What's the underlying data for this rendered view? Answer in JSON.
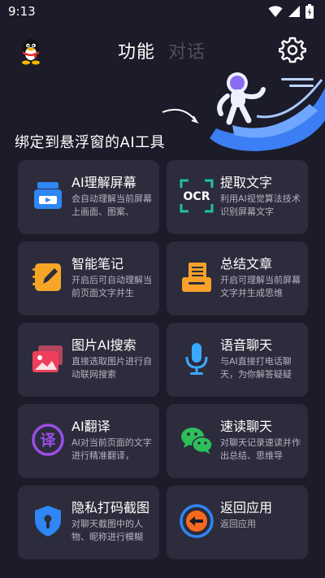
{
  "status_bar": {
    "time": "9:13",
    "icons": [
      "wifi-icon",
      "signal-icon",
      "battery-icon"
    ]
  },
  "header": {
    "tabs": [
      {
        "label": "功能",
        "active": true
      },
      {
        "label": "对话",
        "active": false
      }
    ],
    "icons": [
      "qq-penguin-icon",
      "settings-gear-icon"
    ]
  },
  "hero": {
    "text": "绑定到悬浮窗的AI工具"
  },
  "features": [
    {
      "title": "AI理解屏幕",
      "desc": "会自动理解当前屏幕上画面、图案、",
      "icon": "screen-understand-icon",
      "color": "#2f86f5"
    },
    {
      "title": "提取文字",
      "desc": "利用AI视觉算法技术识别屏幕文字",
      "icon": "ocr-icon",
      "color": "#20c1a2"
    },
    {
      "title": "智能笔记",
      "desc": "开启后可自动理解当前页面文字并生",
      "icon": "notes-icon",
      "color": "#f6a627"
    },
    {
      "title": "总结文章",
      "desc": "开启可理解当前屏幕文字并生成思维",
      "icon": "summary-icon",
      "color": "#f7a12a"
    },
    {
      "title": "图片AI搜索",
      "desc": "直接选取图片进行自动联网搜索",
      "icon": "image-search-icon",
      "color": "#ee3f5d"
    },
    {
      "title": "语音聊天",
      "desc": "与AI直接打电话聊天，为你解答疑疑",
      "icon": "microphone-icon",
      "color": "#39a9ff"
    },
    {
      "title": "AI翻译",
      "desc": "AI对当前页面的文字进行精准翻译，",
      "icon": "translate-icon",
      "color": "#9b4ee8"
    },
    {
      "title": "速读聊天",
      "desc": "对聊天记录速读并作出总结、思维导",
      "icon": "wechat-icon",
      "color": "#2cc05a"
    },
    {
      "title": "隐私打码截图",
      "desc": "对聊天截图中的人物、昵称进行模糊",
      "icon": "privacy-shield-icon",
      "color": "#2f86f5"
    },
    {
      "title": "返回应用",
      "desc": "返回应用",
      "icon": "back-arrow-icon",
      "color": "#f56a1f"
    }
  ]
}
